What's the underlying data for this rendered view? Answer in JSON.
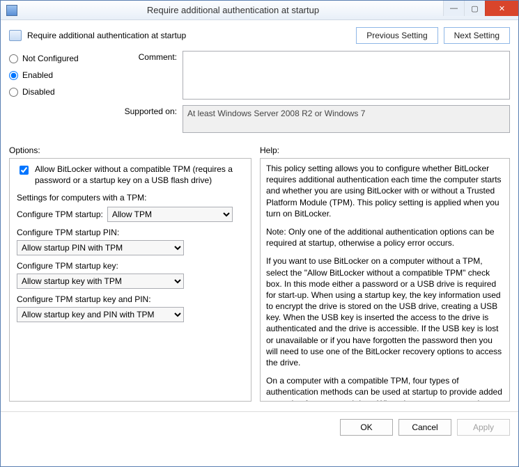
{
  "window": {
    "title": "Require additional authentication at startup",
    "minimize_glyph": "—",
    "maximize_glyph": "▢",
    "close_glyph": "✕"
  },
  "header": {
    "policy_title": "Require additional authentication at startup",
    "prev_label": "Previous Setting",
    "next_label": "Next Setting"
  },
  "state": {
    "not_configured": "Not Configured",
    "enabled": "Enabled",
    "disabled": "Disabled",
    "selected": "enabled"
  },
  "fields": {
    "comment_label": "Comment:",
    "comment_value": "",
    "supported_label": "Supported on:",
    "supported_value": "At least Windows Server 2008 R2 or Windows 7"
  },
  "panes": {
    "options_label": "Options:",
    "help_label": "Help:"
  },
  "options": {
    "allow_no_tpm_label": "Allow BitLocker without a compatible TPM (requires a password or a startup key on a USB flash drive)",
    "allow_no_tpm_checked": true,
    "tpm_subhead": "Settings for computers with a TPM:",
    "cfg_tpm_label": "Configure TPM startup:",
    "cfg_tpm_value": "Allow TPM",
    "cfg_pin_label": "Configure TPM startup PIN:",
    "cfg_pin_value": "Allow startup PIN with TPM",
    "cfg_key_label": "Configure TPM startup key:",
    "cfg_key_value": "Allow startup key with TPM",
    "cfg_keypin_label": "Configure TPM startup key and PIN:",
    "cfg_keypin_value": "Allow startup key and PIN with TPM"
  },
  "help": {
    "p1": "This policy setting allows you to configure whether BitLocker requires additional authentication each time the computer starts and whether you are using BitLocker with or without a Trusted Platform Module (TPM). This policy setting is applied when you turn on BitLocker.",
    "p2": "Note: Only one of the additional authentication options can be required at startup, otherwise a policy error occurs.",
    "p3": "If you want to use BitLocker on a computer without a TPM, select the \"Allow BitLocker without a compatible TPM\" check box. In this mode either a password or a USB drive is required for start-up. When using a startup key, the key information used to encrypt the drive is stored on the USB drive, creating a USB key. When the USB key is inserted the access to the drive is authenticated and the drive is accessible. If the USB key is lost or unavailable or if you have forgotten the password then you will need to use one of the BitLocker recovery options to access the drive.",
    "p4": "On a computer with a compatible TPM, four types of authentication methods can be used at startup to provide added protection for encrypted data. When the computer starts, it can use only the TPM for authentication, or it can also require insertion of a USB flash drive containing a startup key, the entry of a 4-digit to 20-digit personal"
  },
  "footer": {
    "ok": "OK",
    "cancel": "Cancel",
    "apply": "Apply"
  }
}
